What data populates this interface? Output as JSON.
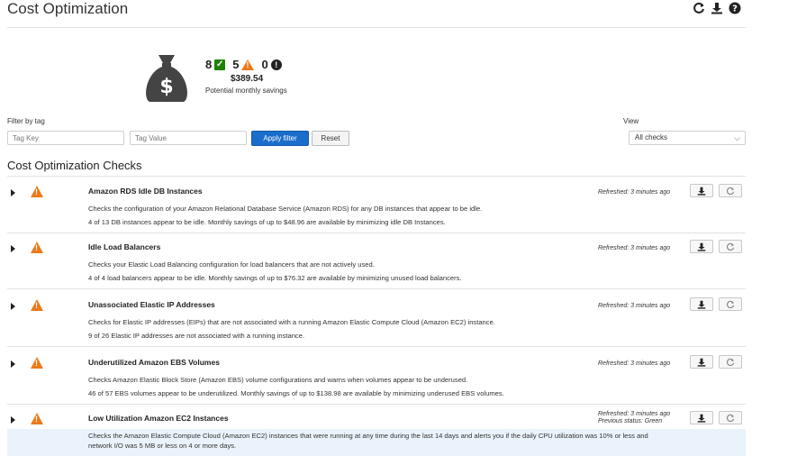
{
  "page": {
    "title": "Cost Optimization",
    "icons": [
      "refresh-icon",
      "download-icon",
      "help-icon"
    ]
  },
  "summary": {
    "ok_count": "8",
    "warn_count": "5",
    "error_count": "0",
    "savings_amount": "$389.54",
    "savings_label": "Potential monthly savings"
  },
  "filter": {
    "label": "Filter by tag",
    "key_placeholder": "Tag Key",
    "value_placeholder": "Tag Value",
    "apply_label": "Apply filter",
    "reset_label": "Reset"
  },
  "view": {
    "label": "View",
    "selected": "All checks"
  },
  "section_title": "Cost Optimization Checks",
  "colors": {
    "warn": "#eb7a1a",
    "ok": "#1d8102",
    "primary": "#1a6dcb"
  },
  "checks": [
    {
      "name": "Amazon RDS Idle DB Instances",
      "line1": "Checks the configuration of your Amazon Relational Database Service (Amazon RDS) for any DB instances that appear to be idle.",
      "line2": "4 of 13 DB instances appear to be idle. Monthly savings of up to $48.96 are available by minimizing idle DB Instances.",
      "refreshed": "Refreshed: 3 minutes ago",
      "status": ""
    },
    {
      "name": "Idle Load Balancers",
      "line1": "Checks your Elastic Load Balancing configuration for load balancers that are not actively used.",
      "line2": "4 of 4 load balancers appear to be idle. Monthly savings of up to $76.32 are available by minimizing unused load balancers.",
      "refreshed": "Refreshed: 3 minutes ago",
      "status": ""
    },
    {
      "name": "Unassociated Elastic IP Addresses",
      "line1": "Checks for Elastic IP addresses (EIPs) that are not associated with a running Amazon Elastic Compute Cloud (Amazon EC2) instance.",
      "line2": "9 of 26 Elastic IP addresses are not associated with a running instance.",
      "refreshed": "Refreshed: 3 minutes ago",
      "status": ""
    },
    {
      "name": "Underutilized Amazon EBS Volumes",
      "line1": "Checks Amazon Elastic Block Store (Amazon EBS) volume configurations and warns when volumes appear to be underused.",
      "line2": "46 of 57 EBS volumes appear to be underutilized. Monthly savings of up to $138.98 are available by minimizing underused EBS volumes.",
      "refreshed": "Refreshed: 3 minutes ago",
      "status": ""
    },
    {
      "name": "Low Utilization Amazon EC2 Instances",
      "line1": "Checks the Amazon Elastic Compute Cloud (Amazon EC2) instances that were running at any time during the last 14 days and alerts you if the daily CPU utilization was 10% or less and",
      "line2": "network I/O was 5 MB or less on 4 or more days.",
      "refreshed": "Refreshed: 3 minutes ago",
      "status": "Previous status: Green"
    }
  ]
}
